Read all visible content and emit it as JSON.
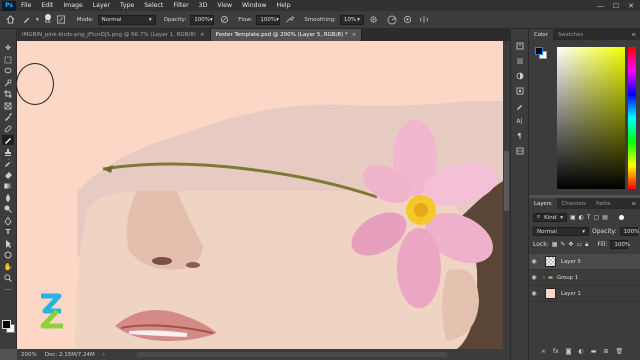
{
  "menu": {
    "logo": "Ps",
    "items": [
      "File",
      "Edit",
      "Image",
      "Layer",
      "Type",
      "Select",
      "Filter",
      "3D",
      "View",
      "Window",
      "Help"
    ],
    "window_controls": [
      "—",
      "☐",
      "✕"
    ]
  },
  "options_bar": {
    "brush_size": "60",
    "mode_label": "Mode:",
    "mode_value": "Normal",
    "opacity_label": "Opacity:",
    "opacity_value": "100%",
    "flow_label": "Flow:",
    "flow_value": "100%",
    "smoothing_label": "Smoothing:",
    "smoothing_value": "10%"
  },
  "tabs": [
    {
      "label": "IMGBIN_pink-birds-png_jFtcnDjS.png @ 66.7% (Layer 1, RGB/8)",
      "close": "×"
    },
    {
      "label": "Poster Template.psd @ 200% (Layer 5, RGB/8) *",
      "close": "×"
    }
  ],
  "status": {
    "zoom": "200%",
    "doc": "Doc: 2.15M/7.24M"
  },
  "color_panel": {
    "tabs": [
      "Color",
      "Swatches"
    ]
  },
  "layers_panel": {
    "tabs": [
      "Layers",
      "Channels",
      "Paths"
    ],
    "kind_label": "Kind",
    "blend_mode": "Normal",
    "opacity_label": "Opacity:",
    "opacity_value": "100%",
    "lock_label": "Lock:",
    "fill_label": "Fill:",
    "fill_value": "100%",
    "layers": [
      {
        "name": "Layer 5"
      },
      {
        "name": "Group 1"
      },
      {
        "name": "Layer 1"
      }
    ]
  },
  "colors": {
    "canvas_bg": "#fcd7c6",
    "panel_bg": "#3c3c3c",
    "accent": "#31a8ff"
  }
}
